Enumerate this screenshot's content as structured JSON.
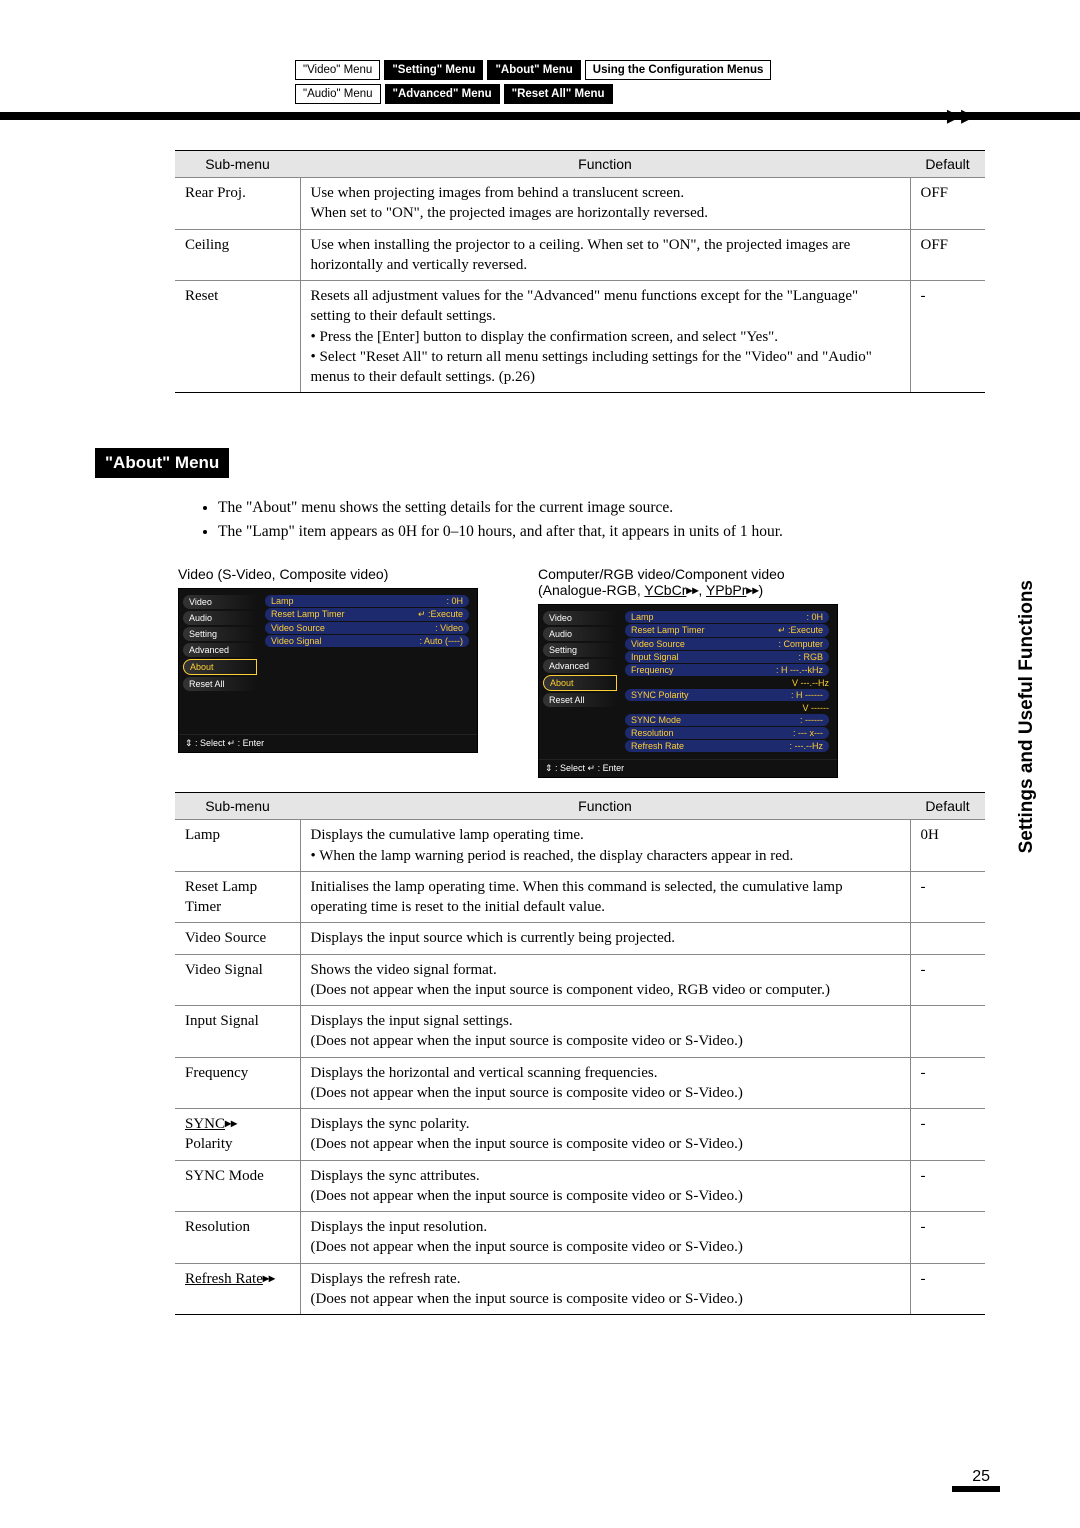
{
  "tabs": {
    "row1": [
      "\"Video\" Menu",
      "\"Setting\" Menu",
      "\"About\" Menu",
      "Using the Configuration Menus"
    ],
    "row2": [
      "\"Audio\" Menu",
      "\"Advanced\" Menu",
      "\"Reset All\" Menu"
    ]
  },
  "table1": {
    "headers": [
      "Sub-menu",
      "Function",
      "Default"
    ],
    "rows": [
      {
        "name": "Rear Proj.",
        "func": "Use when projecting images from behind a translucent screen.\nWhen set to \"ON\", the projected images are horizontally reversed.",
        "def": "OFF"
      },
      {
        "name": "Ceiling",
        "func": "Use when installing the projector to a ceiling. When set to \"ON\", the projected images are horizontally and vertically reversed.",
        "def": "OFF"
      },
      {
        "name": "Reset",
        "func": "Resets all adjustment values for the \"Advanced\" menu functions except for the \"Language\" setting to their default settings.\n• Press the [Enter] button to display the confirmation screen, and select \"Yes\".\n• Select \"Reset All\" to return all menu settings including settings for the \"Video\" and \"Audio\" menus to their default settings. (p.26)",
        "def": "-"
      }
    ]
  },
  "section_title": "\"About\" Menu",
  "bullets": [
    "The \"About\" menu shows the setting details for the current image source.",
    "The \"Lamp\" item appears as 0H for 0–10 hours, and after that, it appears in units of 1 hour."
  ],
  "caption1": "Video (S-Video, Composite video)",
  "caption2_a": "Computer/RGB video/Component video",
  "caption2_b_prefix": "(Analogue-RGB, ",
  "caption2_b_y1": "YCbCr",
  "caption2_b_mid": ", ",
  "caption2_b_y2": "YPbPr",
  "caption2_b_suffix": ")",
  "osd_left": [
    "Video",
    "Audio",
    "Setting",
    "Advanced",
    "About",
    "Reset All"
  ],
  "osd1": [
    {
      "k": "Lamp",
      "v": ": 0H"
    },
    {
      "k": "Reset Lamp Timer",
      "v": "↵ :Execute"
    },
    {
      "k": "Video Source",
      "v": ": Video"
    },
    {
      "k": "Video Signal",
      "v": ": Auto (----)"
    }
  ],
  "osd2": [
    {
      "k": "Lamp",
      "v": ": 0H"
    },
    {
      "k": "Reset Lamp Timer",
      "v": "↵ :Execute"
    },
    {
      "k": "Video Source",
      "v": ": Computer"
    },
    {
      "k": "Input Signal",
      "v": ": RGB"
    },
    {
      "k": "Frequency",
      "v": ": H ---.--kHz"
    },
    {
      "k": "",
      "v": "  V ---.--Hz"
    },
    {
      "k": "SYNC Polarity",
      "v": ": H ------"
    },
    {
      "k": "",
      "v": "  V ------"
    },
    {
      "k": "SYNC Mode",
      "v": ": ------"
    },
    {
      "k": "Resolution",
      "v": ": --- x---"
    },
    {
      "k": "Refresh Rate",
      "v": ": ---.--Hz"
    }
  ],
  "osd_footer": "⇕ : Select   ↵ : Enter",
  "table2": {
    "headers": [
      "Sub-menu",
      "Function",
      "Default"
    ],
    "rows": [
      {
        "name": "Lamp",
        "func": "Displays the cumulative lamp operating time.\n• When the lamp warning period is reached, the display characters appear in red.",
        "def": "0H"
      },
      {
        "name": "Reset Lamp Timer",
        "func": "Initialises the lamp operating time. When this command is selected, the cumulative lamp operating time is reset to the initial default value.",
        "def": "-"
      },
      {
        "name": "Video Source",
        "func": "Displays the input source which is currently being projected.",
        "def": ""
      },
      {
        "name": "Video Signal",
        "func": "Shows the video signal format.\n(Does not appear when the input source is component video, RGB video or computer.)",
        "def": "-"
      },
      {
        "name": "Input Signal",
        "func": "Displays the input signal settings.\n(Does not appear when the input source is composite video or S-Video.)",
        "def": ""
      },
      {
        "name": "Frequency",
        "func": "Displays the horizontal and vertical scanning frequencies.\n(Does not appear when the input source is composite video or S-Video.)",
        "def": "-"
      },
      {
        "name": "SYNC  Polarity",
        "name_plain": "SYNC",
        "name_extra": "Polarity",
        "func": "Displays the sync polarity.\n(Does not appear when the input source is composite video or S-Video.)",
        "def": "-"
      },
      {
        "name": "SYNC Mode",
        "func": "Displays the sync attributes.\n(Does not appear when the input source is composite video or S-Video.)",
        "def": "-"
      },
      {
        "name": "Resolution",
        "func": "Displays the input resolution.\n(Does not appear when the input source is composite video or S-Video.)",
        "def": "-"
      },
      {
        "name": "Refresh Rate",
        "func": "Displays the refresh rate.\n(Does not appear when the input source is composite video or S-Video.)",
        "def": "-"
      }
    ]
  },
  "side_label": "Settings and Useful Functions",
  "page_num": "25"
}
